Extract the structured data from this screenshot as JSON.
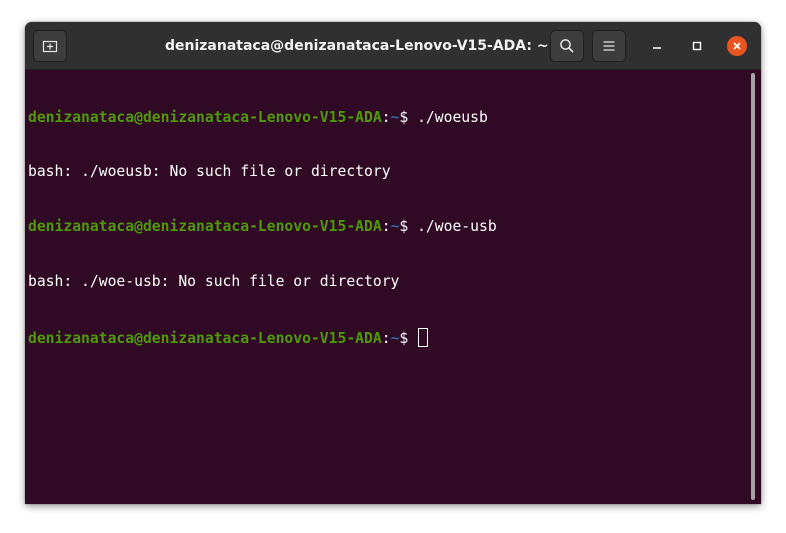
{
  "window": {
    "title": "denizanataca@denizanataca-Lenovo-V15-ADA: ~"
  },
  "titlebar": {
    "icons": {
      "new_tab": "new-tab-icon",
      "search": "search-icon",
      "menu": "hamburger-menu-icon",
      "minimize": "minimize-icon",
      "maximize": "maximize-icon",
      "close": "close-icon"
    },
    "colors": {
      "close": "#e95420",
      "bar": "#303030"
    }
  },
  "terminal": {
    "colors": {
      "background": "#300a24",
      "user_host": "#4e9a06",
      "path": "#3465a4",
      "text": "#ffffff"
    },
    "lines": [
      {
        "user": "denizanataca@denizanataca-Lenovo-V15-ADA",
        "sep": ":",
        "path": "~",
        "symbol": "$ ",
        "command": "./woeusb"
      },
      {
        "output": "bash: ./woeusb: No such file or directory"
      },
      {
        "user": "denizanataca@denizanataca-Lenovo-V15-ADA",
        "sep": ":",
        "path": "~",
        "symbol": "$ ",
        "command": "./woe-usb"
      },
      {
        "output": "bash: ./woe-usb: No such file or directory"
      },
      {
        "user": "denizanataca@denizanataca-Lenovo-V15-ADA",
        "sep": ":",
        "path": "~",
        "symbol": "$ ",
        "command": ""
      }
    ]
  }
}
